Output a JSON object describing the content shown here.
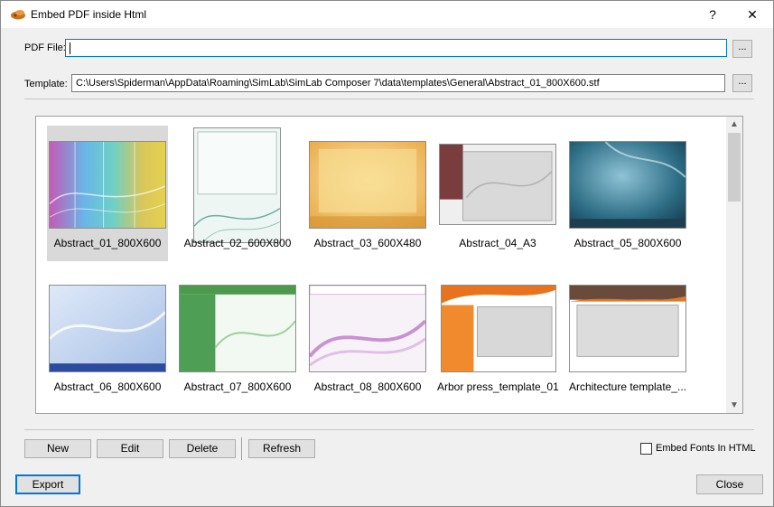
{
  "window": {
    "title": "Embed PDF inside Html",
    "help_label": "?",
    "close_label": "✕",
    "icon": "simlab-logo-icon"
  },
  "pdf_file": {
    "label": "PDF File:",
    "value": "",
    "browse_label": "..."
  },
  "template": {
    "label": "Template:",
    "value": "C:\\Users\\Spiderman\\AppData\\Roaming\\SimLab\\SimLab Composer 7\\data\\templates\\General\\Abstract_01_800X600.stf",
    "browse_label": "..."
  },
  "gallery": {
    "selected_index": 0,
    "items": [
      {
        "label": "Abstract_01_800X600"
      },
      {
        "label": "Abstract_02_600X800"
      },
      {
        "label": "Abstract_03_600X480"
      },
      {
        "label": "Abstract_04_A3"
      },
      {
        "label": "Abstract_05_800X600"
      },
      {
        "label": "Abstract_06_800X600"
      },
      {
        "label": "Abstract_07_800X600"
      },
      {
        "label": "Abstract_08_800X600"
      },
      {
        "label": "Arbor press_template_01"
      },
      {
        "label": "Architecture template_..."
      }
    ]
  },
  "buttons": {
    "new": "New",
    "edit": "Edit",
    "delete": "Delete",
    "refresh": "Refresh",
    "export": "Export",
    "close": "Close"
  },
  "embed_fonts": {
    "label": "Embed Fonts In HTML",
    "checked": false
  },
  "colors": {
    "accent": "#0078d7",
    "selection": "#d9d9d9"
  }
}
